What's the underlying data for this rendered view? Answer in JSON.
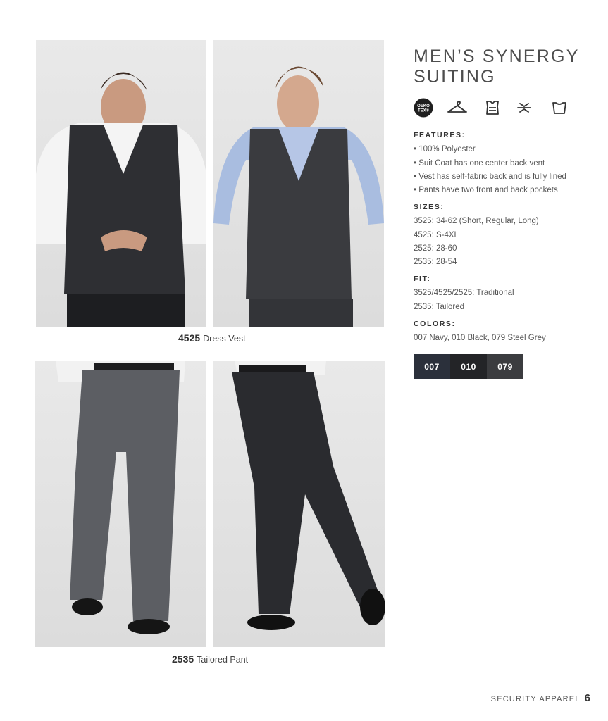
{
  "title": "MEN’S SYNERGY SUITING",
  "icons": [
    "oeko-tex-icon",
    "hanger-icon",
    "lined-garment-icon",
    "vent-icon",
    "waistband-icon"
  ],
  "oeko_label": "OEKO TEX®",
  "features": {
    "heading": "FEATURES:",
    "items": [
      "• 100% Polyester",
      "• Suit Coat has one center back vent",
      "• Vest has self-fabric back and is fully lined",
      "• Pants have two front and back pockets"
    ]
  },
  "sizes": {
    "heading": "SIZES:",
    "items": [
      "3525: 34-62 (Short, Regular, Long)",
      "4525: S-4XL",
      "2525: 28-60",
      "2535: 28-54"
    ]
  },
  "fit": {
    "heading": "FIT:",
    "items": [
      "3525/4525/2525: Traditional",
      "2535: Tailored"
    ]
  },
  "colors": {
    "heading": "COLORS:",
    "text": "007 Navy, 010 Black, 079 Steel Grey",
    "swatches": [
      {
        "code": "007",
        "hex": "#2b303b"
      },
      {
        "code": "010",
        "hex": "#232427"
      },
      {
        "code": "079",
        "hex": "#3b3c3f"
      }
    ]
  },
  "captions": {
    "vest": {
      "code": "4525",
      "label": "Dress Vest"
    },
    "pant": {
      "code": "2535",
      "label": "Tailored Pant"
    }
  },
  "footer": {
    "section": "SECURITY APPAREL",
    "page": "6"
  }
}
